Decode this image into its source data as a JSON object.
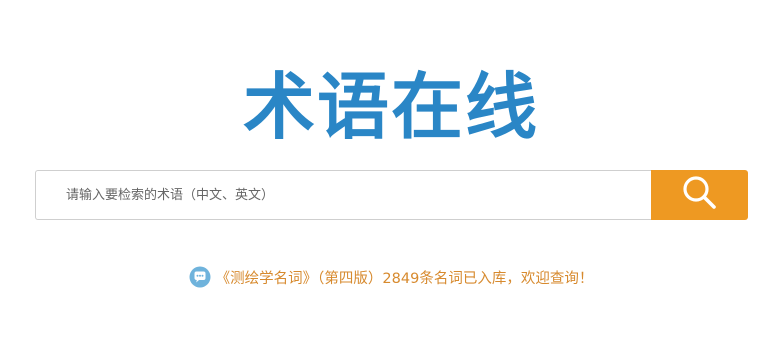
{
  "logo": {
    "text": "术语在线"
  },
  "search": {
    "placeholder": "请输入要检索的术语（中文、英文）",
    "value": ""
  },
  "notice": {
    "text": "《测绘学名词》（第四版）2849条名词已入库，欢迎查询！"
  },
  "colors": {
    "brand": "#2a86c6",
    "search_button": "#ee9922",
    "notice_text": "#d78a2e",
    "notice_icon": "#6fb3dc"
  },
  "icons": {
    "search_button": "search-icon",
    "notice": "chat-bubble-icon"
  }
}
